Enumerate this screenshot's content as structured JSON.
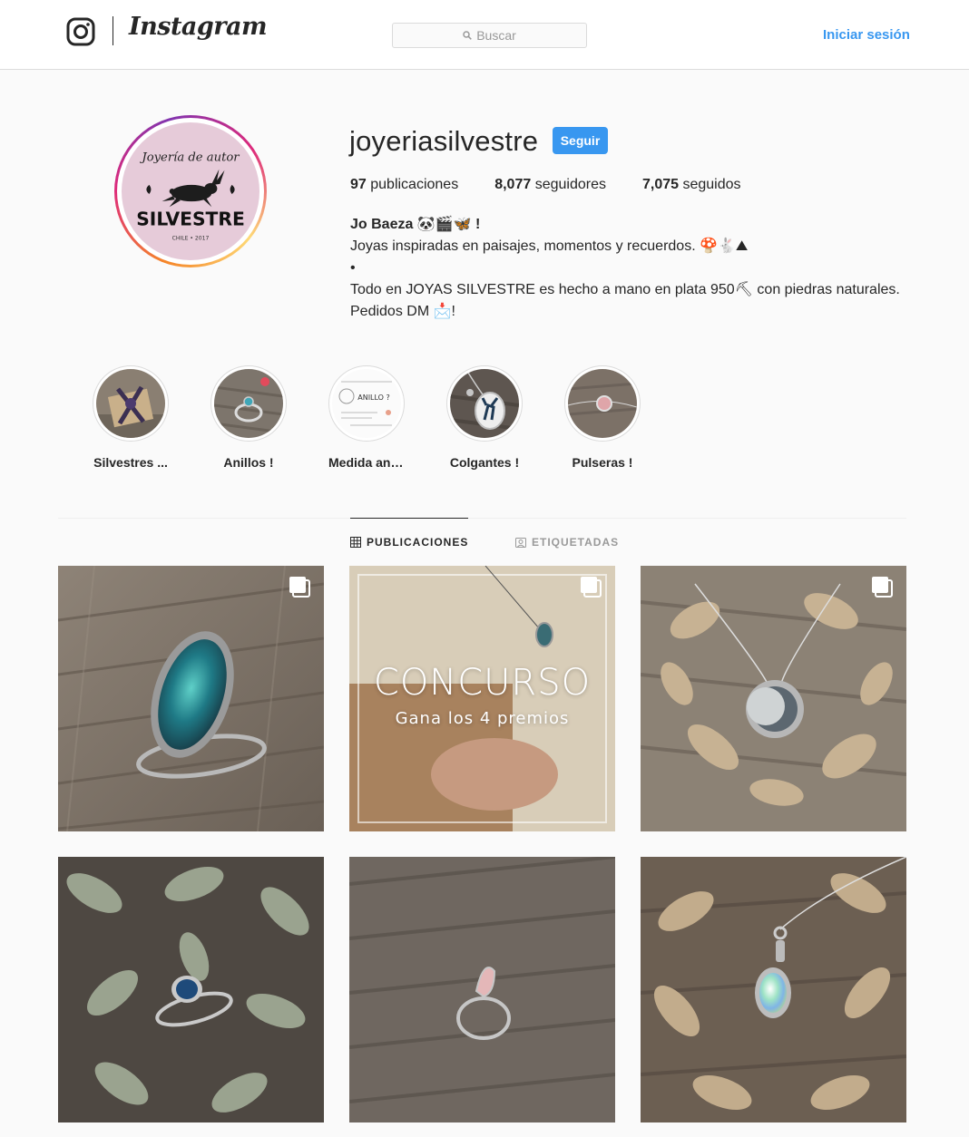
{
  "nav": {
    "wordmark": "Instagram",
    "search_placeholder": "Buscar",
    "login_label": "Iniciar sesión"
  },
  "profile": {
    "username": "joyeriasilvestre",
    "follow_label": "Seguir",
    "stats": {
      "posts_count": "97",
      "posts_label": "publicaciones",
      "followers_count": "8,077",
      "followers_label": "seguidores",
      "following_count": "7,075",
      "following_label": "seguidos"
    },
    "bio": {
      "name": "Jo Baeza 🐼🎬🦋 !",
      "line1": "Joyas inspiradas en paisajes, momentos y recuerdos. 🍄🐇⛰",
      "line2": "•",
      "line3": "Todo en JOYAS SILVESTRE es hecho a mano en plata 950⛏ con piedras naturales.",
      "line4": "Pedidos DM 📩!"
    },
    "avatar_text": {
      "script": "Joyería de autor",
      "brand": "SILVESTRE",
      "footer": "CHILE • 2017"
    }
  },
  "highlights": [
    {
      "label": "Silvestres ..."
    },
    {
      "label": "Anillos !"
    },
    {
      "label": "Medida anil..."
    },
    {
      "label": "Colgantes !"
    },
    {
      "label": "Pulseras !"
    }
  ],
  "highlight_texts": {
    "medida_heading": "ANILLO ?"
  },
  "tabs": {
    "posts": "PUBLICACIONES",
    "tagged": "ETIQUETADAS"
  },
  "posts": {
    "concurso_title": "CONCURSO",
    "concurso_sub": "Gana los 4 premios"
  },
  "colors": {
    "accent": "#3897f0",
    "border": "#dbdbdb",
    "background": "#fafafa"
  }
}
